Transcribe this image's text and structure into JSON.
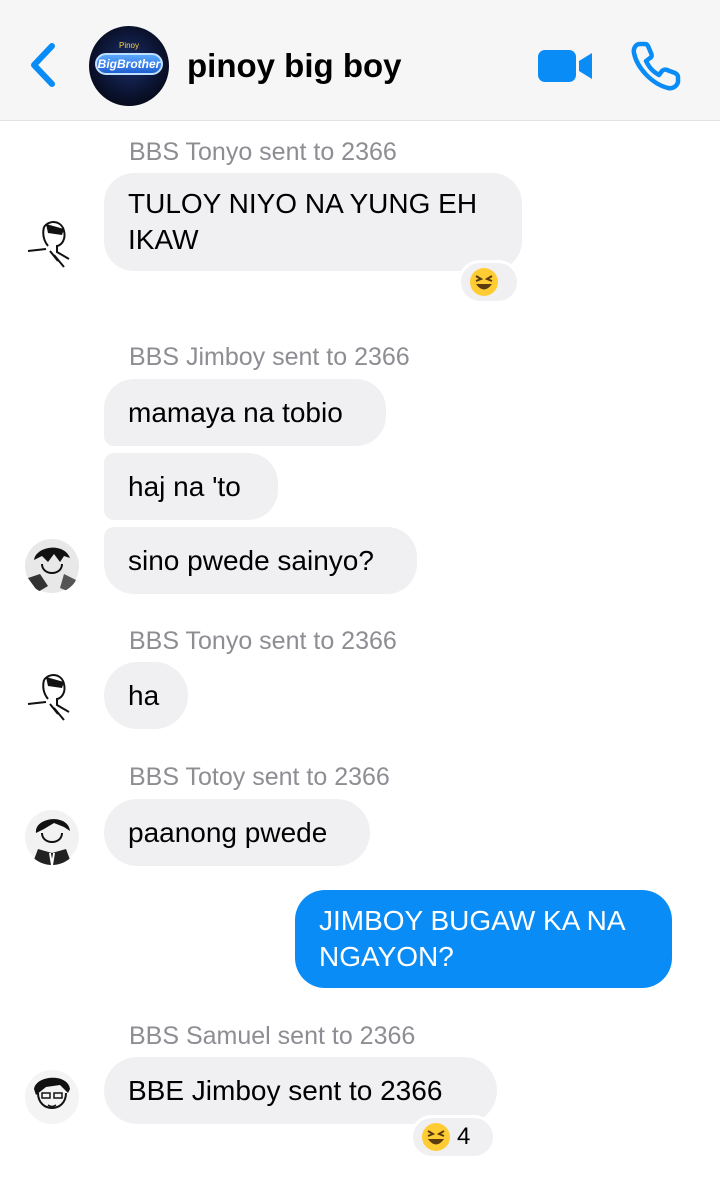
{
  "header": {
    "title": "pinoy big boy",
    "avatar_logo_text": "BigBrother",
    "avatar_top_text": "Pinoy"
  },
  "messages": [
    {
      "sender": "BBS Tonyo sent to 2366",
      "lines": [
        "TULOY NIYO NA YUNG EH",
        "IKAW"
      ],
      "reaction": "laughing-emoji"
    },
    {
      "sender": "BBS Jimboy sent to 2366",
      "lines": [
        "mamaya na tobio"
      ]
    },
    {
      "lines": [
        "haj na 'to"
      ]
    },
    {
      "lines": [
        "sino pwede sainyo?"
      ]
    },
    {
      "sender": "BBS Tonyo sent to 2366",
      "lines": [
        "ha"
      ]
    },
    {
      "sender": "BBS Totoy sent to 2366",
      "lines": [
        "paanong pwede"
      ]
    },
    {
      "outgoing": true,
      "lines": [
        "JIMBOY BUGAW KA NA",
        "NGAYON?"
      ]
    },
    {
      "sender": "BBS Samuel sent to 2366",
      "lines": [
        "BBE Jimboy sent to 2366"
      ],
      "reaction": "laughing-emoji",
      "reaction_count": "4"
    }
  ],
  "colors": {
    "accent": "#0a8cf7",
    "incoming_bubble": "#f0f0f2",
    "sender_text": "#8d8d93",
    "header_bg": "#f6f6f7"
  }
}
